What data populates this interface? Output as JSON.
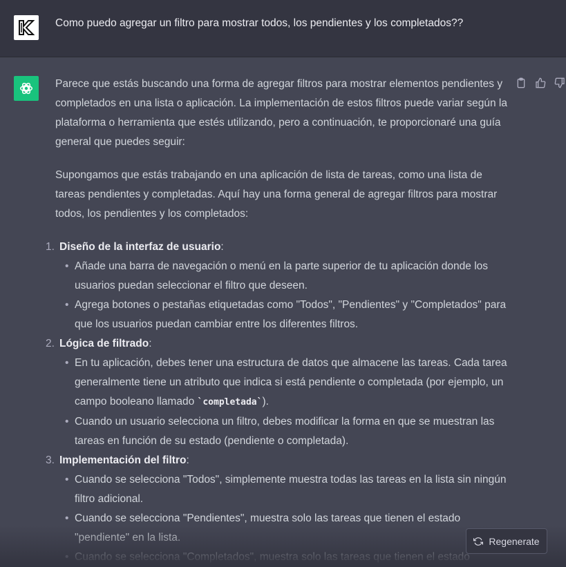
{
  "user": {
    "avatar_icon": "k-logo-icon",
    "message": "Como puedo agregar un filtro para mostrar todos, los pendientes y los completados??"
  },
  "assistant": {
    "avatar_icon": "openai-logo-icon",
    "actions": [
      "clipboard-icon",
      "thumbs-up-icon",
      "thumbs-down-icon"
    ],
    "paragraphs": [
      "Parece que estás buscando una forma de agregar filtros para mostrar elementos pendientes y completados en una lista o aplicación. La implementación de estos filtros puede variar según la plataforma o herramienta que estés utilizando, pero a continuación, te proporcionaré una guía general que puedes seguir:",
      "Supongamos que estás trabajando en una aplicación de lista de tareas, como una lista de tareas pendientes y completadas. Aquí hay una forma general de agregar filtros para mostrar todos, los pendientes y los completados:"
    ],
    "steps": [
      {
        "num": "1.",
        "title": "Diseño de la interfaz de usuario",
        "bullets": [
          "Añade una barra de navegación o menú en la parte superior de tu aplicación donde los usuarios puedan seleccionar el filtro que deseen.",
          "Agrega botones o pestañas etiquetadas como \"Todos\", \"Pendientes\" y \"Completados\" para que los usuarios puedan cambiar entre los diferentes filtros."
        ]
      },
      {
        "num": "2.",
        "title": "Lógica de filtrado",
        "bullet1_pre": "En tu aplicación, debes tener una estructura de datos que almacene las tareas. Cada tarea generalmente tiene un atributo que indica si está pendiente o completada (por ejemplo, un campo booleano llamado ",
        "bullet1_code": "`completada`",
        "bullet1_post": ").",
        "bullet2": "Cuando un usuario selecciona un filtro, debes modificar la forma en que se muestran las tareas en función de su estado (pendiente o completada)."
      },
      {
        "num": "3.",
        "title": "Implementación del filtro",
        "bullets": [
          "Cuando se selecciona \"Todos\", simplemente muestra todas las tareas en la lista sin ningún filtro adicional.",
          "Cuando se selecciona \"Pendientes\", muestra solo las tareas que tienen el estado \"pendiente\" en la lista.",
          "Cuando se selecciona \"Completados\", muestra solo las tareas que tienen el estado"
        ]
      }
    ],
    "colon": ":"
  },
  "regenerate": {
    "icon": "refresh-icon",
    "label": "Regenerate"
  }
}
